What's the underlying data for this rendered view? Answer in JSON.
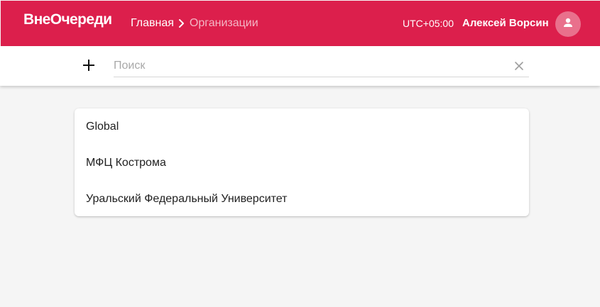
{
  "header": {
    "logo": "ВнеОчереди",
    "breadcrumb": {
      "home": "Главная",
      "current": "Организации"
    },
    "timezone": "UTC+05:00",
    "username": "Алексей Ворсин",
    "avatar_icon": "person-icon",
    "colors": {
      "bar": "#dc1f4c",
      "breadcrumb_current": "#f3b6c5",
      "avatar_bg": "#e9708c"
    }
  },
  "toolbar": {
    "add_icon": "plus-icon",
    "search": {
      "placeholder": "Поиск",
      "value": ""
    },
    "clear_icon": "close-icon"
  },
  "organizations": [
    {
      "name": "Global"
    },
    {
      "name": "МФЦ Кострома"
    },
    {
      "name": "Уральский Федеральный Университет"
    }
  ]
}
